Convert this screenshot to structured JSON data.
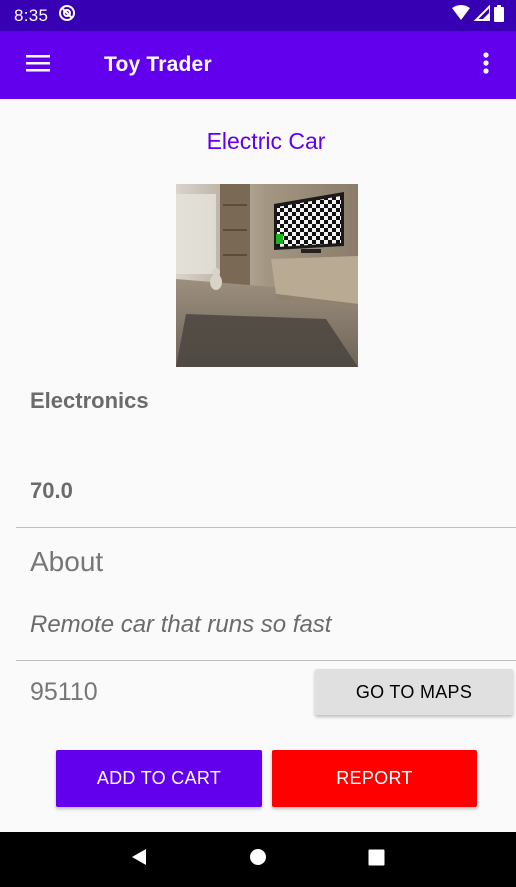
{
  "status_bar": {
    "time": "8:35",
    "icons": [
      "do-not-disturb-icon",
      "wifi-icon",
      "signal-icon",
      "battery-icon"
    ]
  },
  "app_bar": {
    "title": "Toy Trader",
    "icons": [
      "menu-icon",
      "more-vert-icon"
    ]
  },
  "product": {
    "title": "Electric Car",
    "category": "Electronics",
    "price": "70.0",
    "about_heading": "About",
    "description": "Remote car that runs so fast",
    "zip": "95110"
  },
  "buttons": {
    "maps": "GO TO MAPS",
    "add_to_cart": "ADD TO CART",
    "report": "REPORT"
  },
  "nav_bar": {
    "icons": [
      "back-icon",
      "home-icon",
      "recents-icon"
    ]
  },
  "colors": {
    "primary": "#6200ee",
    "primary_dark": "#3700b3",
    "report": "#ff0000"
  }
}
